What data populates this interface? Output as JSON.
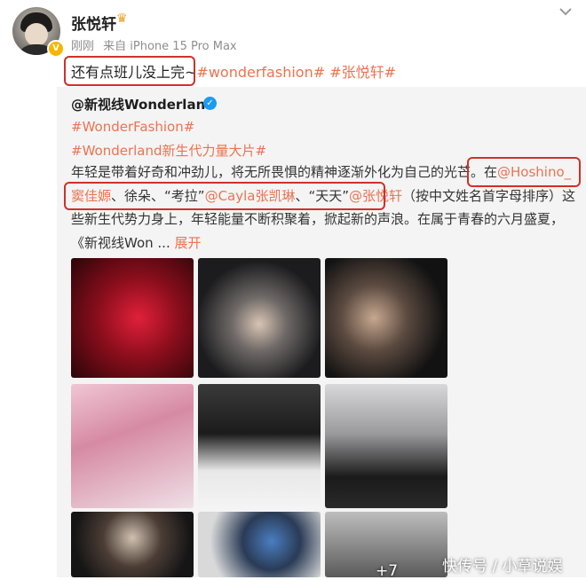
{
  "post": {
    "username": "张悦轩",
    "time": "刚刚",
    "source": "来自 iPhone 15 Pro Max",
    "text": "还有点班儿没上完~",
    "hashtags": [
      "#wonderfashion#",
      "#张悦轩#"
    ]
  },
  "repost": {
    "author": "@新视线Wonderland",
    "tag1": "#WonderFashion#",
    "tag2": "#Wonderland新生代力量大片#",
    "body": {
      "p1": "年轻是带着好奇和冲劲儿，将无所畏惧的精神逐渐外化为自己的光芒。在",
      "mention1": "@Hoshino_窦佳嫄",
      "p2": "、徐朵、“考拉”",
      "mention2": "@Cayla张凯琳",
      "p3": "、“天天”",
      "mention3": "@张悦轩",
      "p4": "（按中文姓名首字母排序）这些新生代势力身上，年轻能量不断积聚着，掀起新的声浪。在属于青春的六月盛夏，《新视线Won ...",
      "expand": "展开"
    },
    "more_photos": "+7"
  },
  "watermark": "快传号 / 小草说娱",
  "colors": {
    "accent": "#eb7350",
    "highlight_box": "#d0302a",
    "verified": "#1d9bf0"
  },
  "icons": {
    "menu": "chevron-down-icon",
    "verified": "verified-icon",
    "crown": "crown-icon"
  }
}
